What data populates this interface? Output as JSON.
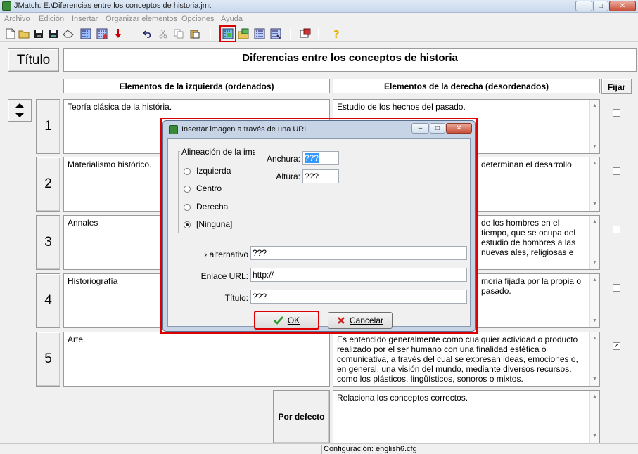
{
  "window": {
    "title": "JMatch: E:\\Diferencias entre los conceptos de historia.jmt"
  },
  "menu": [
    "Archivo",
    "Edición",
    "Insertar",
    "Organizar elementos",
    "Opciones",
    "Ayuda"
  ],
  "toolbar": {
    "icons": [
      "new-file-icon",
      "open-folder-icon",
      "save-icon",
      "save-as-icon",
      "eraser-icon",
      "export-web-icon",
      "export-web-alt-icon",
      "export-down-icon",
      "undo-icon",
      "cut-icon",
      "copy-icon",
      "paste-icon",
      "insert-image-url-icon",
      "insert-image-file-icon",
      "insert-link-icon",
      "insert-link-alt-icon",
      "config-icon",
      "help-icon"
    ],
    "highlighted": "insert-image-url-icon"
  },
  "editor": {
    "title_label": "Título",
    "title_value": "Diferencias entre los conceptos de historia",
    "left_header": "Elementos de la izquierda (ordenados)",
    "right_header": "Elementos de la derecha (desordenados)",
    "fix_header": "Fijar",
    "rows": [
      {
        "num": "1",
        "left": "Teoría clásica de la história.",
        "right": "Estudio de los hechos del pasado.",
        "fixed": false
      },
      {
        "num": "2",
        "left": "Materialismo histórico.",
        "right": "determinan el desarrollo",
        "fixed": false
      },
      {
        "num": "3",
        "left": "Annales",
        "right": "de los hombres en el tiempo, que se ocupa del estudio de hombres a las nuevas ales, religiosas e",
        "fixed": false
      },
      {
        "num": "4",
        "left": "Historiografía",
        "right": "moria fijada por la propia o pasado.",
        "fixed": false
      },
      {
        "num": "5",
        "left": "Arte",
        "right": "Es entendido generalmente como cualquier actividad o producto realizado por el ser humano con una finalidad estética o comunicativa, a través del cual se expresan ideas, emociones o, en general, una visión del mundo, mediante diversos recursos, como los plásticos, lingüísticos, sonoros o mixtos.",
        "fixed": true
      }
    ],
    "default_label": "Por defecto",
    "default_value": "Relaciona los conceptos correctos."
  },
  "status": {
    "config": "Configuración: english6.cfg"
  },
  "dialog": {
    "title": "Insertar imagen a través de una URL",
    "alignment_group": "Alineación de la ima",
    "options": [
      {
        "label": "Izquierda",
        "selected": false
      },
      {
        "label": "Centro",
        "selected": false
      },
      {
        "label": "Derecha",
        "selected": false
      },
      {
        "label": "[Ninguna]",
        "selected": true
      }
    ],
    "width_label": "Anchura:",
    "width_value": "???",
    "height_label": "Altura:",
    "height_value": "???",
    "alt_label": "› alternativo",
    "alt_value": "???",
    "url_label": "Enlace URL:",
    "url_value": "http://",
    "title_label": "Título:",
    "title_value": "???",
    "ok_label": "OK",
    "cancel_label": "Cancelar"
  }
}
